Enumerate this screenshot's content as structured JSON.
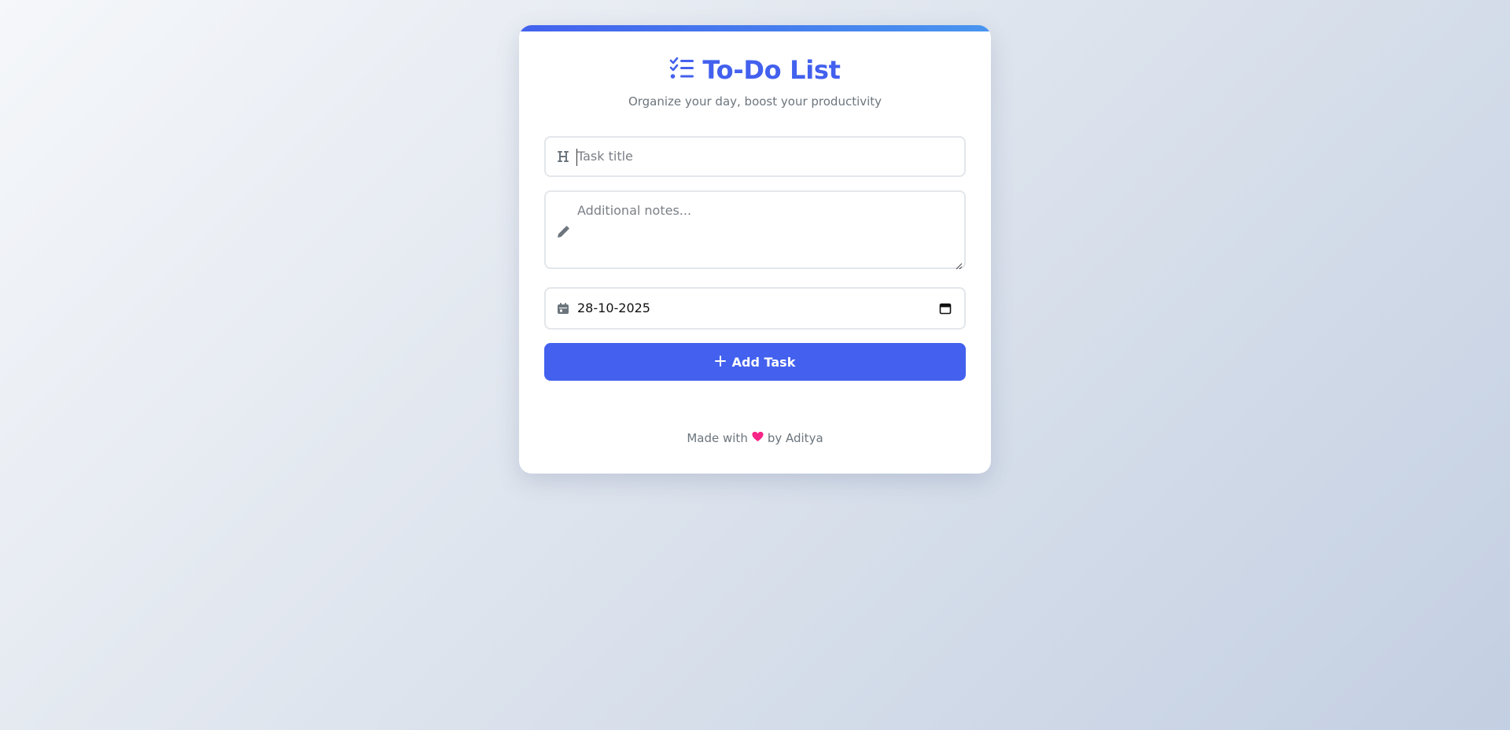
{
  "app": {
    "title": "To-Do List",
    "subtitle": "Organize your day, boost your productivity"
  },
  "form": {
    "title_placeholder": "Task title",
    "notes_placeholder": "Additional notes...",
    "due_date_value": "28-10-2025",
    "add_button_label": "Add Task"
  },
  "footer": {
    "prefix": "Made with",
    "suffix": "by Aditya"
  },
  "icons": {
    "header": "list-check-icon",
    "title_field": "heading-icon",
    "notes_field": "pencil-icon",
    "date_field": "calendar-icon",
    "add_button": "plus-icon",
    "footer": "heart-icon"
  },
  "colors": {
    "accent": "#4361ee",
    "accent_gradient_end": "#4895ef",
    "heart": "#f72585",
    "muted_text": "#6c757d",
    "field_border": "#e3e6ea"
  }
}
